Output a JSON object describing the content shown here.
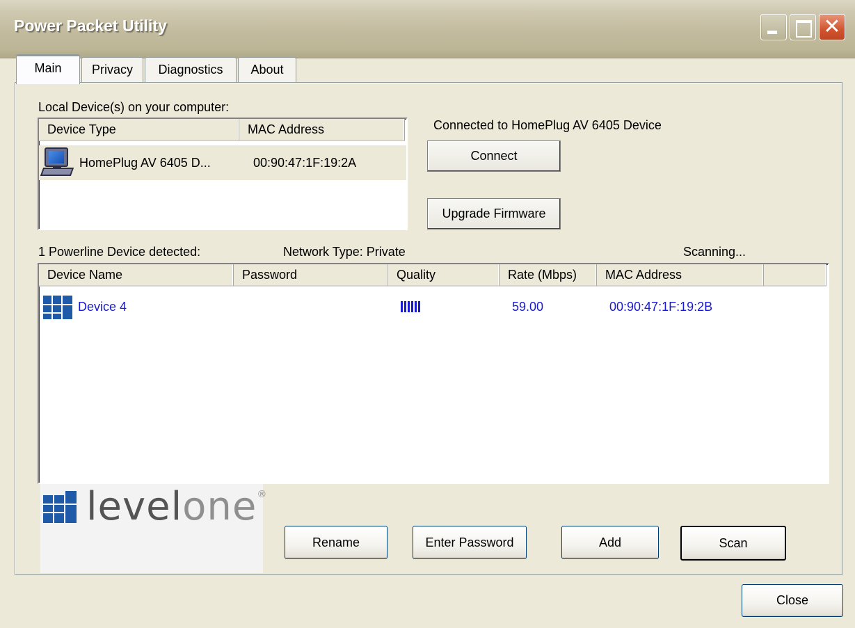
{
  "window": {
    "title": "Power Packet Utility",
    "close_glyph": "✕"
  },
  "tabs": [
    {
      "label": "Main",
      "active": true
    },
    {
      "label": "Privacy",
      "active": false
    },
    {
      "label": "Diagnostics",
      "active": false
    },
    {
      "label": "About",
      "active": false
    }
  ],
  "local": {
    "section_label": "Local Device(s) on your computer:",
    "columns": [
      "Device Type",
      "MAC Address"
    ],
    "rows": [
      {
        "icon": "computer-icon",
        "device_type": "HomePlug AV 6405 D...",
        "mac": "00:90:47:1F:19:2A"
      }
    ],
    "connected_text": "Connected to HomePlug AV 6405 Device",
    "connect_label": "Connect",
    "upgrade_label": "Upgrade Firmware"
  },
  "powerline": {
    "detected_text": "1 Powerline Device detected:",
    "network_type_text": "Network Type: Private",
    "status_text": "Scanning...",
    "columns": [
      "Device Name",
      "Password",
      "Quality",
      "Rate (Mbps)",
      "MAC Address"
    ],
    "rows": [
      {
        "icon": "levelone-device-icon",
        "name": "Device 4",
        "password": "",
        "quality_bars": 6,
        "rate": "59.00",
        "mac": "00:90:47:1F:19:2B"
      }
    ]
  },
  "logo": {
    "text_part1": "level",
    "text_part2": "one",
    "mark": "®"
  },
  "buttons": {
    "rename": "Rename",
    "enter_password": "Enter Password",
    "add": "Add",
    "scan": "Scan",
    "close": "Close"
  },
  "colors": {
    "link_blue": "#1a1ad0",
    "brand_blue": "#1e5aa8",
    "tab_highlight": "#ffc83c"
  }
}
